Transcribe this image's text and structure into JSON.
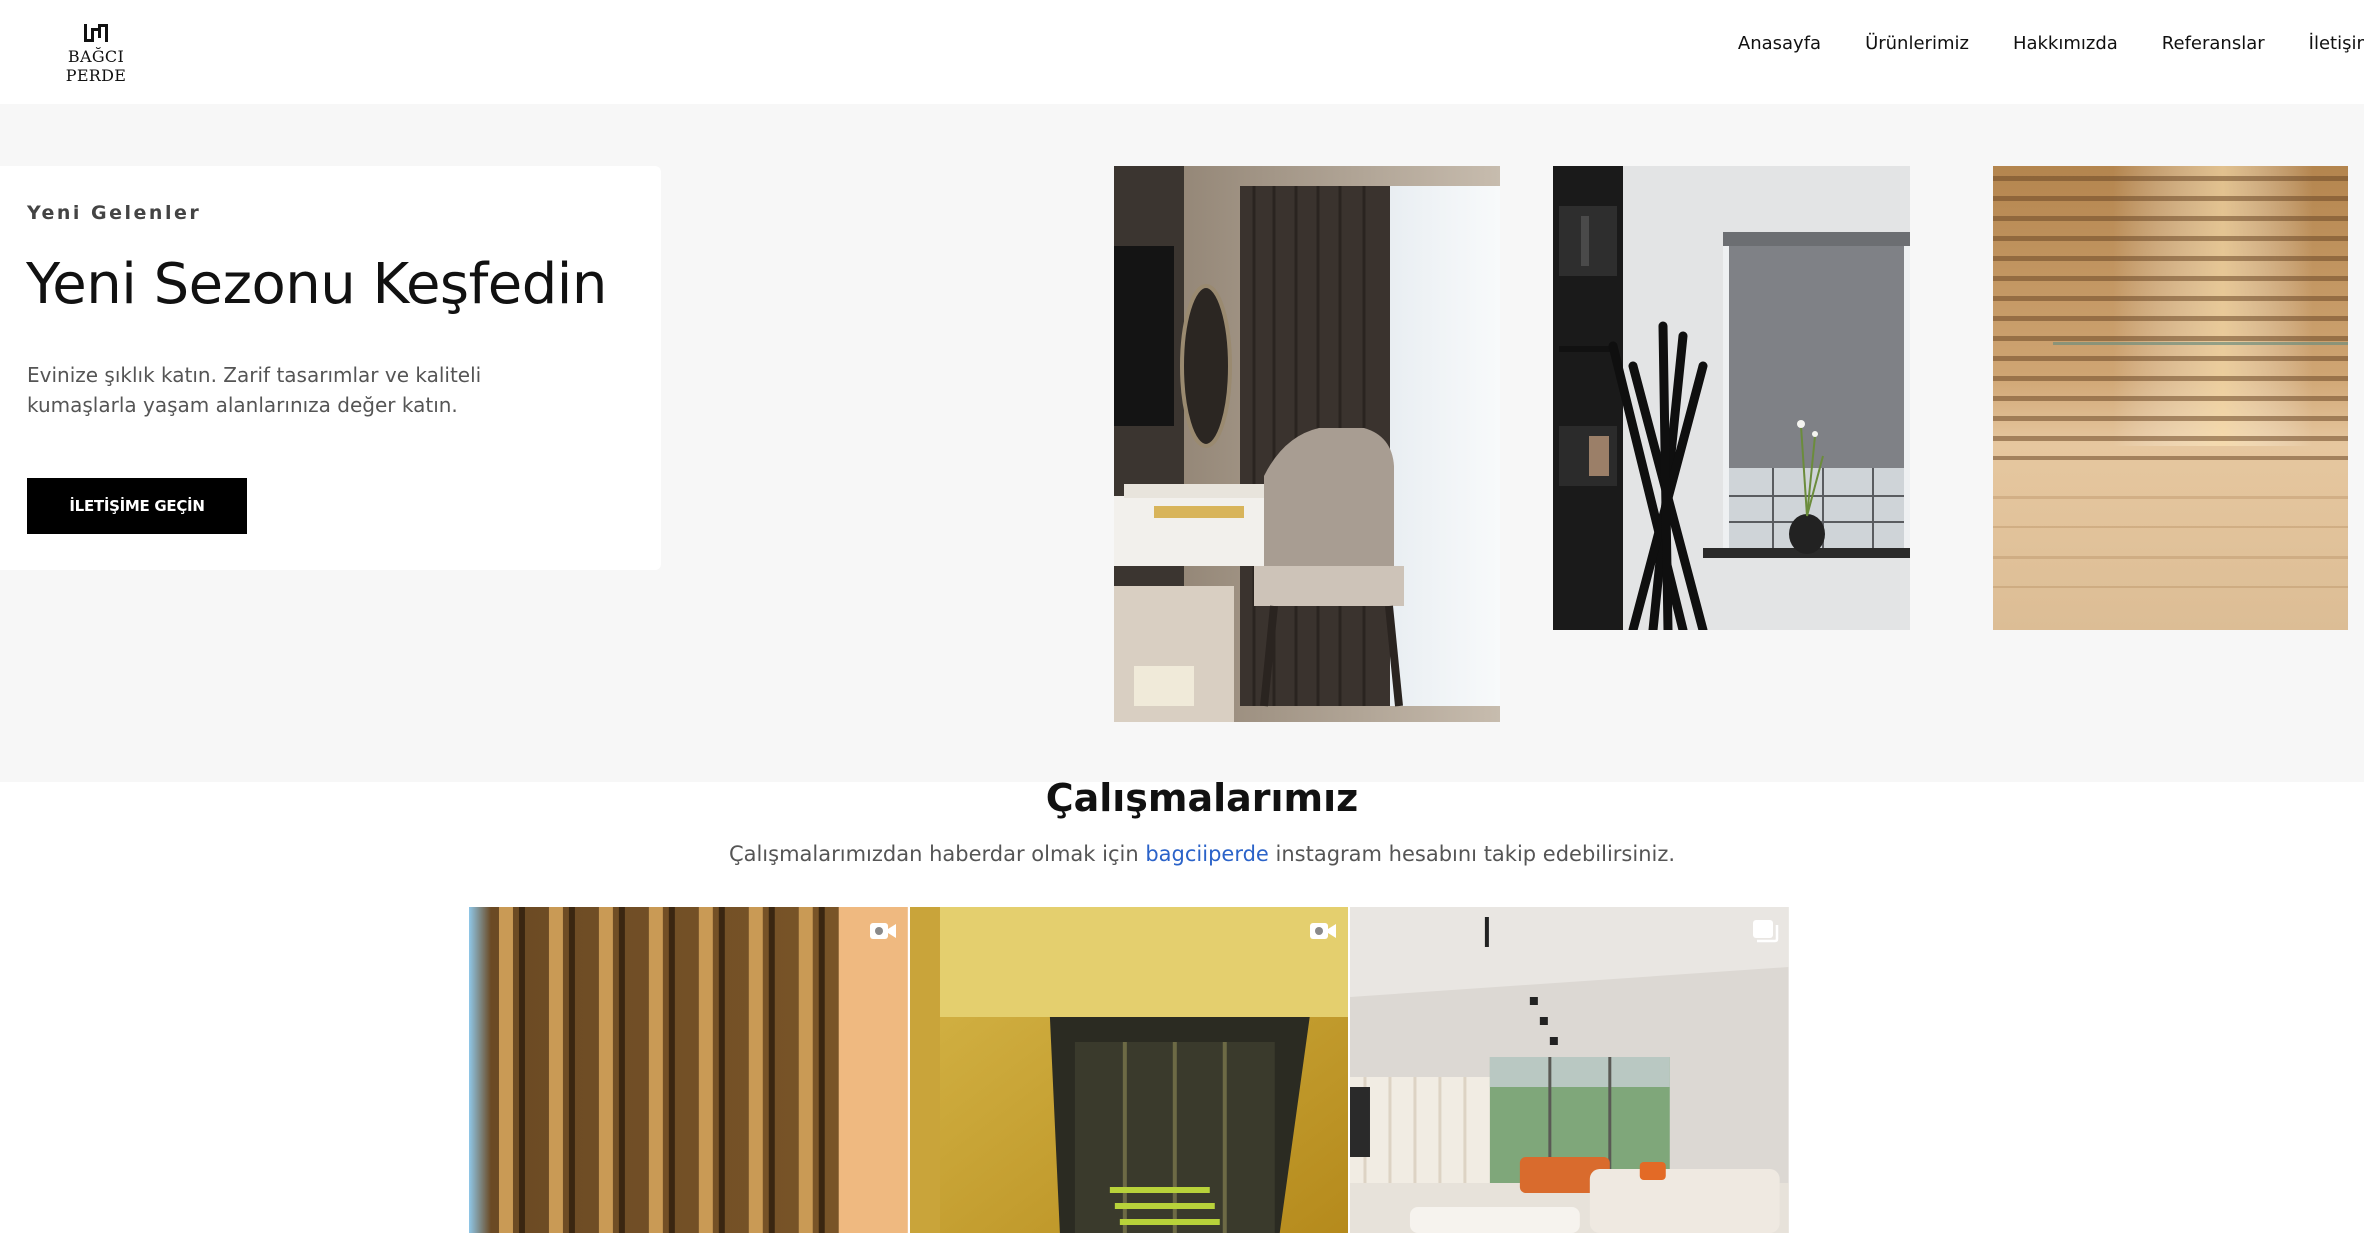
{
  "header": {
    "logo_text": "BAĞCI PERDE",
    "nav": [
      "Anasayfa",
      "Ürünlerimiz",
      "Hakkımızda",
      "Referanslar",
      "İletişim"
    ]
  },
  "hero": {
    "eyebrow": "Yeni Gelenler",
    "title": "Yeni Sezonu Keşfedin",
    "description": "Evinize şıklık katın. Zarif tasarımlar ve kaliteli kumaşlarla yaşam alanlarınıza değer katın.",
    "cta_label": "İLETİŞİME GEÇİN",
    "images": [
      "curtain-room-photo",
      "roller-blind-photo",
      "wooden-blind-photo"
    ]
  },
  "works": {
    "title": "Çalışmalarımız",
    "subtitle_before": "Çalışmalarımızdan haberdar olmak için ",
    "instagram_handle": "bagciiperde",
    "subtitle_after": " instagram hesabını takip edebilirsiniz.",
    "tiles": [
      {
        "type": "video",
        "icon": "video-icon"
      },
      {
        "type": "video",
        "icon": "video-icon"
      },
      {
        "type": "carousel",
        "icon": "carousel-icon"
      }
    ]
  },
  "colors": {
    "accent_link": "#2b63c9",
    "button_bg": "#000000",
    "hero_bg": "#f7f7f7"
  }
}
